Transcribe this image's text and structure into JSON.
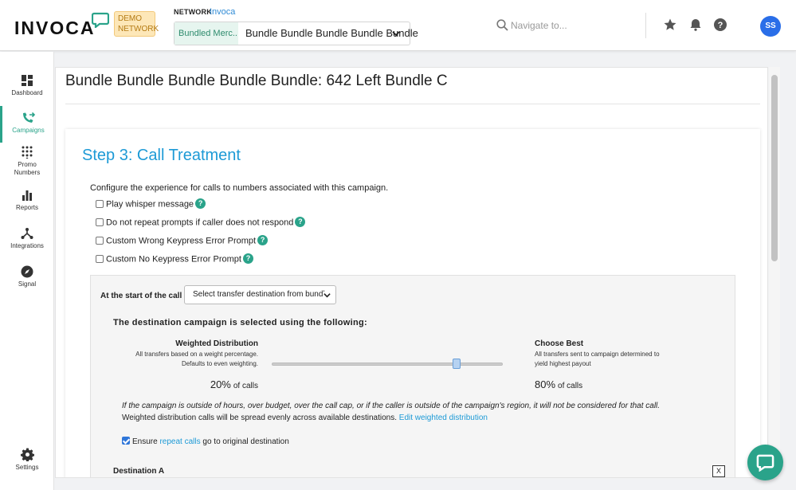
{
  "header": {
    "logo_text": "INVOCA",
    "demo_badge": "DEMO NETWORK",
    "network_label": "NETWORK",
    "network_value": "Invoca",
    "selector_left": "Bundled Merc...",
    "selector_right": "Bundle Bundle Bundle Bundle Bundle",
    "search_placeholder": "Navigate to...",
    "avatar_initials": "SS"
  },
  "sidebar": {
    "items": [
      {
        "label": "Dashboard",
        "icon": "dashboard-icon"
      },
      {
        "label": "Campaigns",
        "icon": "phone-transfer-icon"
      },
      {
        "label": "Promo Numbers",
        "icon": "dialpad-icon"
      },
      {
        "label": "Reports",
        "icon": "bar-chart-icon"
      },
      {
        "label": "Integrations",
        "icon": "integrations-icon"
      },
      {
        "label": "Signal",
        "icon": "compass-icon"
      },
      {
        "label": "Settings",
        "icon": "gear-icon"
      }
    ]
  },
  "page": {
    "title": "Bundle Bundle Bundle Bundle Bundle: 642 Left Bundle C"
  },
  "step": {
    "title": "Step 3: Call Treatment",
    "configure_text": "Configure the experience for calls to numbers associated with this campaign.",
    "checkboxes": [
      {
        "label": "Play whisper message",
        "checked": false
      },
      {
        "label": "Do not repeat prompts if caller does not respond",
        "checked": false
      },
      {
        "label": "Custom Wrong Keypress Error Prompt",
        "checked": false
      },
      {
        "label": "Custom No Keypress Error Prompt",
        "checked": false
      }
    ]
  },
  "transfer": {
    "start_label": "At the start of the call",
    "select_value": "Select transfer destination from bundle",
    "destination_heading": "The destination campaign is selected using the following:",
    "weighted": {
      "title": "Weighted Distribution",
      "desc_line1": "All transfers based on a weight percentage.",
      "desc_line2": "Defaults to even weighting.",
      "percent": "20%",
      "unit": "of calls"
    },
    "slider_value": 0.8,
    "choose_best": {
      "title": "Choose Best",
      "desc_line1": "All transfers sent to campaign determined to",
      "desc_line2": "yield highest payout",
      "percent": "80%",
      "unit": "of calls"
    },
    "note_italic": "If the campaign is outside of hours, over budget, over the call cap, or if the caller is outside of the campaign's region, it will not be considered for that call.",
    "note_plain": "Weighted distribution calls will be spread evenly across available destinations.",
    "edit_link": "Edit weighted distribution",
    "ensure_prefix": "Ensure",
    "ensure_link": "repeat calls",
    "ensure_suffix": "go to original destination",
    "ensure_checked": true,
    "destination_a": "Destination A",
    "close_label": "X"
  },
  "colors": {
    "accent_teal": "#2aa38a",
    "link_blue": "#1d9ad6",
    "avatar_blue": "#2a6ee8"
  }
}
